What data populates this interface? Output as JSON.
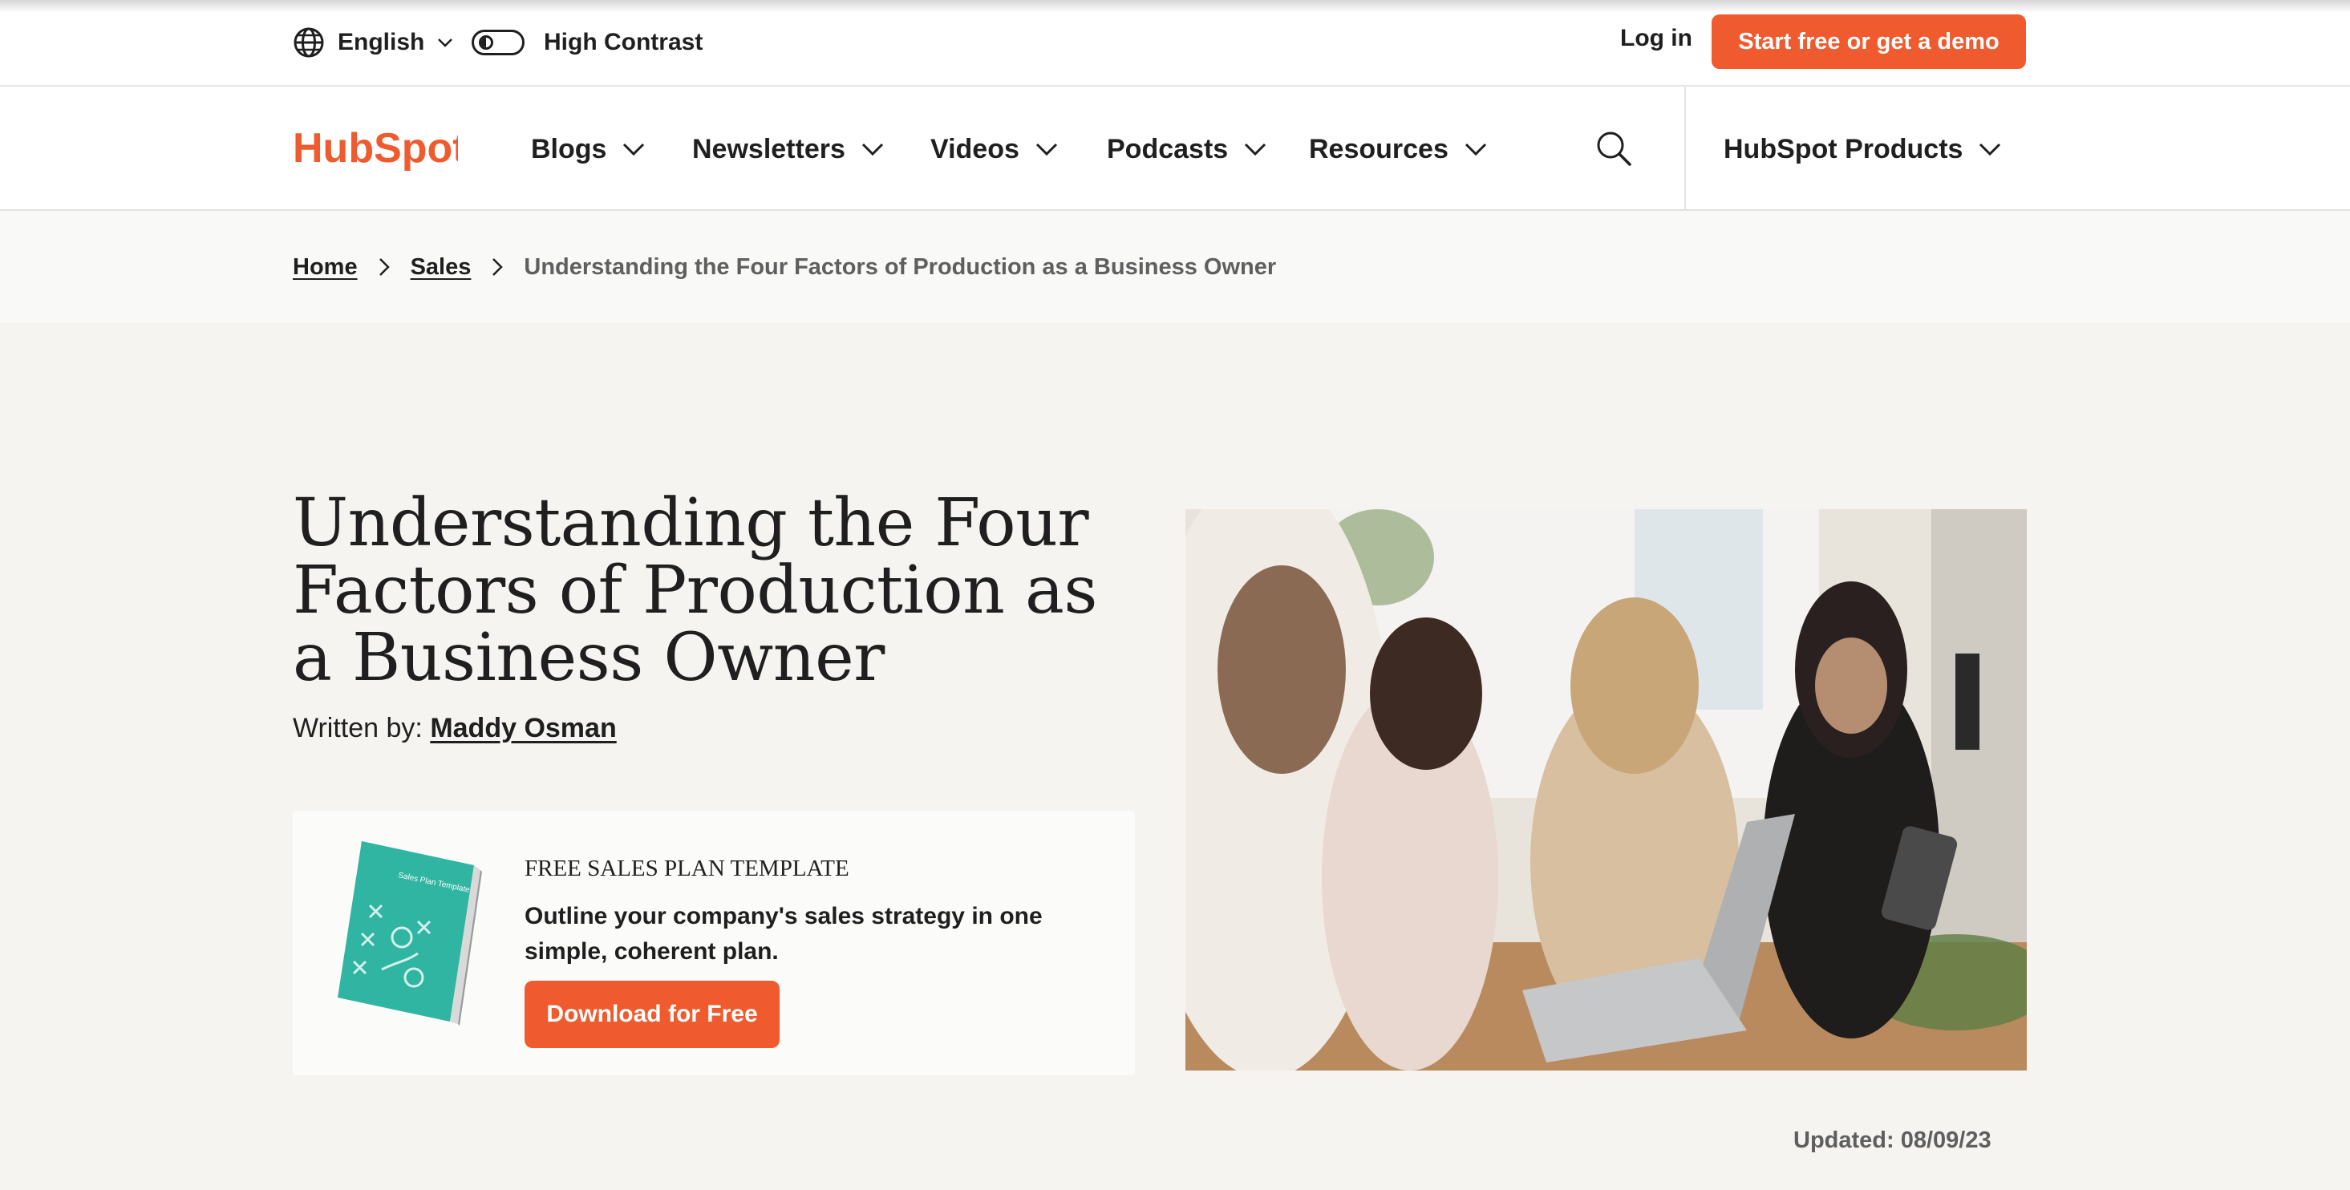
{
  "utility": {
    "language": "English",
    "contrast_label": "High Contrast",
    "login": "Log in",
    "cta": "Start free or get a demo"
  },
  "nav": {
    "logo_text": "HubSpot",
    "items": [
      {
        "label": "Blogs"
      },
      {
        "label": "Newsletters"
      },
      {
        "label": "Videos"
      },
      {
        "label": "Podcasts"
      },
      {
        "label": "Resources"
      }
    ],
    "products": "HubSpot Products"
  },
  "breadcrumb": {
    "home": "Home",
    "section": "Sales",
    "current": "Understanding the Four Factors of Production as a Business Owner"
  },
  "article": {
    "title": "Understanding the Four Factors of Production as a Business Owner",
    "byline_prefix": "Written by:",
    "author": "Maddy Osman",
    "updated": "Updated: 08/09/23"
  },
  "offer": {
    "kicker": "FREE SALES PLAN TEMPLATE",
    "description": "Outline your company's sales strategy in one simple, coherent plan.",
    "button": "Download for Free"
  },
  "icons": {
    "globe": "globe-icon",
    "chevron": "chevron-down-icon",
    "chevron_right": "chevron-right-icon",
    "search": "search-icon"
  },
  "colors": {
    "accent": "#ef5b2e",
    "hero_bg": "#f5f4f0",
    "text": "#1f1f1f"
  }
}
